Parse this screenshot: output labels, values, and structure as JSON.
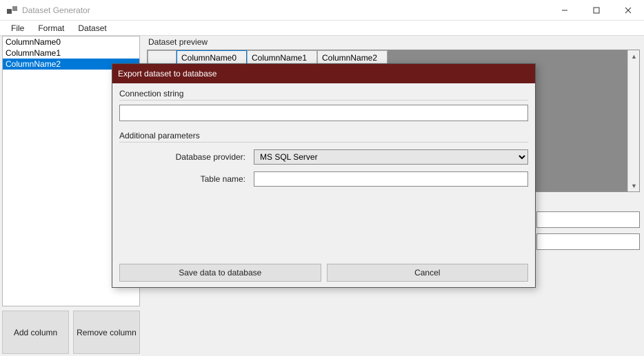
{
  "window": {
    "title": "Dataset Generator"
  },
  "menu": {
    "items": [
      "File",
      "Format",
      "Dataset"
    ]
  },
  "column_list": {
    "items": [
      "ColumnName0",
      "ColumnName1",
      "ColumnName2"
    ],
    "selected_index": 2
  },
  "buttons": {
    "add_column": "Add column",
    "remove_column": "Remove column"
  },
  "preview": {
    "label": "Dataset preview",
    "columns": [
      "ColumnName0",
      "ColumnName1",
      "ColumnName2"
    ],
    "active_column_index": 0
  },
  "dialog": {
    "title": "Export dataset to database",
    "connection_label": "Connection string",
    "connection_value": "",
    "additional_label": "Additional parameters",
    "provider_label": "Database provider:",
    "provider_value": "MS SQL Server",
    "table_label": "Table name:",
    "table_value": "",
    "save_label": "Save data to database",
    "cancel_label": "Cancel"
  }
}
